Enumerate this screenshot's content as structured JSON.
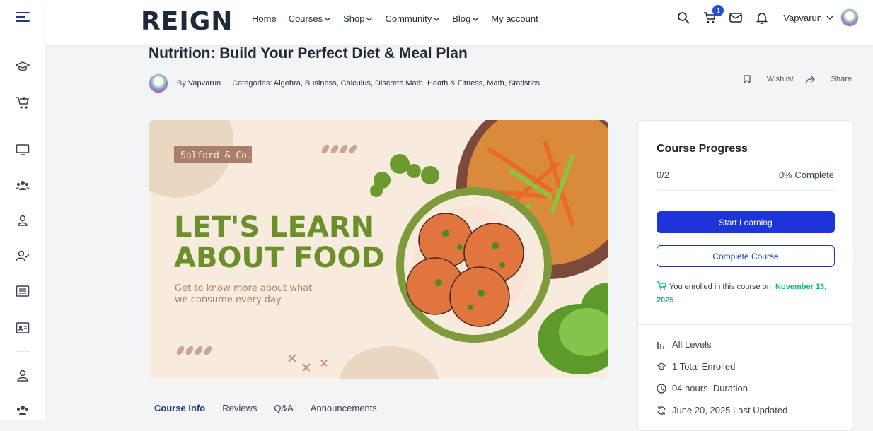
{
  "brand": {
    "logo_text": "REIGN"
  },
  "nav": [
    {
      "label": "Home",
      "has_dropdown": false
    },
    {
      "label": "Courses",
      "has_dropdown": true
    },
    {
      "label": "Shop",
      "has_dropdown": true
    },
    {
      "label": "Community",
      "has_dropdown": true
    },
    {
      "label": "Blog",
      "has_dropdown": true
    },
    {
      "label": "My account",
      "has_dropdown": false
    }
  ],
  "header": {
    "cart_count": "1",
    "username": "Vapvarun"
  },
  "course": {
    "title": "Nutrition: Build Your Perfect Diet & Meal Plan",
    "by_prefix": "By",
    "author": "Vapvarun",
    "categories_prefix": "Categories:",
    "categories": "Algebra, Business, Calculus, Discrete Math, Heath & Fitness, Math, Statistics",
    "wishlist_label": "Wishlist",
    "share_label": "Share"
  },
  "hero": {
    "brand_tag": "Salford & Co.",
    "headline_1": "LET'S LEARN",
    "headline_2": "ABOUT FOOD",
    "subtext_1": "Get to know more about what",
    "subtext_2": "we consume every day"
  },
  "tabs": [
    {
      "label": "Course Info",
      "active": true
    },
    {
      "label": "Reviews",
      "active": false
    },
    {
      "label": "Q&A",
      "active": false
    },
    {
      "label": "Announcements",
      "active": false
    }
  ],
  "progress_card": {
    "title": "Course Progress",
    "count": "0/2",
    "percent_label": "0% Complete",
    "progress_fraction": 0,
    "start_button": "Start Learning",
    "complete_button": "Complete Course",
    "enrolled_text": "You enrolled in this course on",
    "enrolled_date": "November 13, 2025",
    "details": [
      {
        "icon": "level-icon",
        "text": "All Levels"
      },
      {
        "icon": "graduation-cap-icon",
        "text": "1 Total Enrolled"
      },
      {
        "icon": "clock-icon",
        "text": "04 hours  Duration"
      },
      {
        "icon": "refresh-icon",
        "text": "June 20, 2025 Last Updated"
      }
    ]
  },
  "colors": {
    "primary": "#1d35d8",
    "success": "#10b981",
    "hero_green": "#6b8f2a"
  }
}
